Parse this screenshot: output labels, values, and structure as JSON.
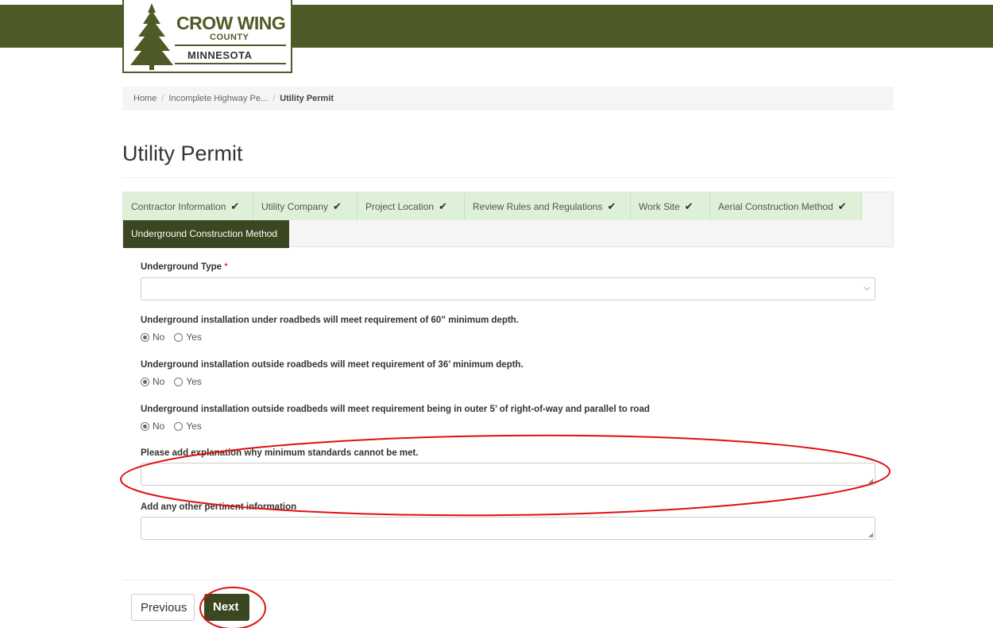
{
  "header": {
    "logo": {
      "name": "CROW WING",
      "county": "COUNTY",
      "state": "MINNESOTA"
    }
  },
  "breadcrumb": [
    "Home",
    "Incomplete Highway Pe...",
    "Utility Permit"
  ],
  "page": {
    "title": "Utility Permit"
  },
  "tabs": [
    {
      "label": "Contractor Information",
      "done": true
    },
    {
      "label": "Utility Company",
      "done": true
    },
    {
      "label": "Project Location",
      "done": true
    },
    {
      "label": "Review Rules and Regulations",
      "done": true
    },
    {
      "label": "Work Site",
      "done": true
    },
    {
      "label": "Aerial Construction Method",
      "done": true
    },
    {
      "label": "Underground Construction Method",
      "done": false,
      "active": true
    }
  ],
  "form": {
    "underground_type": {
      "label": "Underground Type",
      "required_mark": "*",
      "value": ""
    },
    "q1": {
      "label": "Underground installation under roadbeds will meet requirement of 60” minimum depth.",
      "options": [
        "No",
        "Yes"
      ],
      "selected": "No"
    },
    "q2": {
      "label": "Underground installation outside roadbeds will meet requirement of 36’ minimum depth.",
      "options": [
        "No",
        "Yes"
      ],
      "selected": "No"
    },
    "q3": {
      "label": "Underground installation outside roadbeds will meet requirement being in outer 5’ of right-of-way and parallel to road",
      "options": [
        "No",
        "Yes"
      ],
      "selected": "No"
    },
    "explanation": {
      "label": "Please add explanation why minimum standards cannot be met.",
      "value": ""
    },
    "other_info": {
      "label": "Add any other pertinent information",
      "value": ""
    }
  },
  "buttons": {
    "previous": "Previous",
    "next": "Next"
  },
  "colors": {
    "brand": "#4f5b26",
    "active_tab": "#3a4720",
    "done_tab": "#dff0d8",
    "annotation": "#e01010"
  },
  "icons": {
    "tab_done": "check-icon",
    "select": "chevron-down-icon"
  }
}
